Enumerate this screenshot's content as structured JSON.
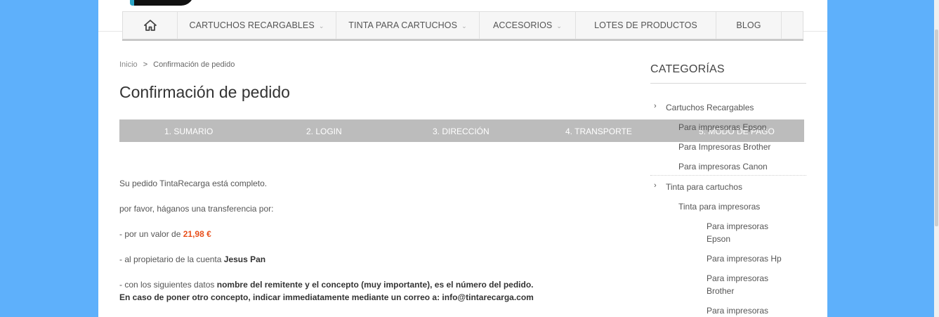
{
  "nav": {
    "items": [
      {
        "label": "CARTUCHOS RECARGABLES",
        "has_submenu": true
      },
      {
        "label": "TINTA PARA CARTUCHOS",
        "has_submenu": true
      },
      {
        "label": "ACCESORIOS",
        "has_submenu": true
      },
      {
        "label": "LOTES DE PRODUCTOS",
        "has_submenu": false
      },
      {
        "label": "BLOG",
        "has_submenu": false
      }
    ],
    "chevron": "⌄"
  },
  "breadcrumb": {
    "home": "Inicio",
    "separator": ">",
    "current": "Confirmación de pedido"
  },
  "page_title": "Confirmación de pedido",
  "steps": [
    "1. SUMARIO",
    "2. LOGIN",
    "3. DIRECCIÓN",
    "4. TRANSPORTE",
    "5. MODO DE PAGO"
  ],
  "content": {
    "line1": "Su pedido TintaRecarga está completo.",
    "line2": "por favor, háganos una transferencia por:",
    "line3_prefix": "- por un valor de ",
    "line3_price": "21,98 €",
    "line4_prefix": "- al propietario de la cuenta ",
    "line4_owner": "Jesus Pan",
    "line5_prefix": "- con los siguientes datos ",
    "line5_bold": "nombre del remitente y el concepto (muy importante), es el número del pedido.",
    "line6_bold": "En caso de poner otro concepto, indicar immediatamente mediante un correo a: info@tintarecarga.com"
  },
  "sidebar": {
    "title": "CATEGORÍAS",
    "arrow": "›",
    "cat1": "Cartuchos Recargables",
    "cat1_sub": [
      "Para impresoras Epson",
      "Para Impresoras Brother",
      "Para impresoras Canon"
    ],
    "cat2": "Tinta para cartuchos",
    "cat2_sub": "Tinta para impresoras",
    "cat2_subsub": [
      "Para impresoras Epson",
      "Para impresoras Hp",
      "Para impresoras Brother",
      "Para impresoras"
    ]
  },
  "colors": {
    "background": "#5eb0fb",
    "price": "#e8501c",
    "steps_bar": "#bcbcbc"
  }
}
